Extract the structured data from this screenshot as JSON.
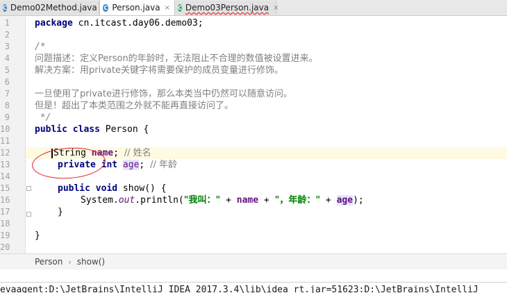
{
  "tabs": [
    {
      "label": "Demo02Method.java",
      "active": false,
      "icon": "java-class-icon"
    },
    {
      "label": "Person.java",
      "active": true,
      "icon": "java-class-icon"
    },
    {
      "label": "Demo03Person.java",
      "active": false,
      "icon": "java-class-icon"
    }
  ],
  "close_glyph": "×",
  "line_numbers": [
    "1",
    "2",
    "3",
    "4",
    "5",
    "6",
    "7",
    "8",
    "9",
    "10",
    "11",
    "12",
    "13",
    "14",
    "15",
    "16",
    "17",
    "18",
    "19",
    "20"
  ],
  "code": {
    "l1_kw": "package",
    "l1_rest": " cn.itcast.day06.demo03;",
    "l3": "/*",
    "l4": "问题描述：定义Person的年龄时，无法阻止不合理的数值被设置进来。",
    "l5": "解决方案：用private关键字将需要保护的成员变量进行修饰。",
    "l7": "一旦使用了private进行修饰，那么本类当中仍然可以随意访问。",
    "l8": "但是！超出了本类范围之外就不能再直接访问了。",
    "l9": " */",
    "l10_kw": "public class",
    "l10_rest": " Person {",
    "l12_type": "String ",
    "l12_field": "name",
    "l12_semi": "; ",
    "l12_comment": "// 姓名",
    "l13_kw": "private int ",
    "l13_field": "age",
    "l13_semi": "; ",
    "l13_comment": "// 年龄",
    "l15_kw": "public void",
    "l15_rest": " show() {",
    "l16_a": "System.",
    "l16_out": "out",
    "l16_b": ".println(",
    "l16_s1": "\"我叫：\"",
    "l16_plus1": " + ",
    "l16_name": "name",
    "l16_plus2": " + ",
    "l16_s2": "\"，年龄：\"",
    "l16_plus3": " + ",
    "l16_age": "age",
    "l16_end": ");",
    "l17": "}",
    "l19": "}"
  },
  "breadcrumb": [
    "Person",
    "show()"
  ],
  "breadcrumb_sep": "›",
  "console_text": "evaagent:D:\\JetBrains\\IntelliJ IDEA 2017.3.4\\lib\\idea_rt.jar=51623:D:\\JetBrains\\IntelliJ"
}
